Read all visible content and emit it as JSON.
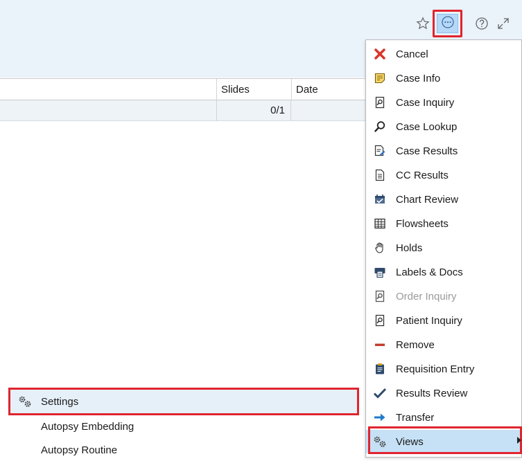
{
  "toolbar": {
    "icons": [
      "star-icon",
      "more-icon",
      "help-icon",
      "expand-icon"
    ]
  },
  "grid": {
    "columns": [
      "Slides",
      "Date"
    ],
    "rows": [
      {
        "slides": "0/1",
        "date": ""
      }
    ]
  },
  "menu": {
    "items": [
      {
        "label": "Cancel",
        "icon": "cancel-x-icon"
      },
      {
        "label": "Case Info",
        "icon": "case-info-icon"
      },
      {
        "label": "Case Inquiry",
        "icon": "inquiry-icon"
      },
      {
        "label": "Case Lookup",
        "icon": "magnifier-icon"
      },
      {
        "label": "Case Results",
        "icon": "case-results-icon"
      },
      {
        "label": "CC Results",
        "icon": "document-icon"
      },
      {
        "label": "Chart Review",
        "icon": "chart-review-icon"
      },
      {
        "label": "Flowsheets",
        "icon": "grid-icon"
      },
      {
        "label": "Holds",
        "icon": "hand-icon"
      },
      {
        "label": "Labels & Docs",
        "icon": "printer-icon"
      },
      {
        "label": "Order Inquiry",
        "icon": "inquiry-icon",
        "disabled": true
      },
      {
        "label": "Patient Inquiry",
        "icon": "inquiry-icon"
      },
      {
        "label": "Remove",
        "icon": "minus-icon"
      },
      {
        "label": "Requisition Entry",
        "icon": "clipboard-icon"
      },
      {
        "label": "Results Review",
        "icon": "check-icon"
      },
      {
        "label": "Transfer",
        "icon": "arrow-right-icon"
      },
      {
        "label": "Views",
        "icon": "gears-icon",
        "has_submenu": true
      }
    ]
  },
  "submenu": {
    "items": [
      {
        "label": "Settings",
        "icon": "gears-icon"
      },
      {
        "label": "Autopsy Embedding"
      },
      {
        "label": "Autopsy Routine"
      }
    ]
  },
  "colors": {
    "highlight_border": "#e0242e",
    "hover_bg": "#c6e1f6",
    "header_bg": "#eaf2fa",
    "cancel_red": "#d9362b",
    "remove_red": "#c0392b",
    "transfer_blue": "#1f7ac9"
  }
}
